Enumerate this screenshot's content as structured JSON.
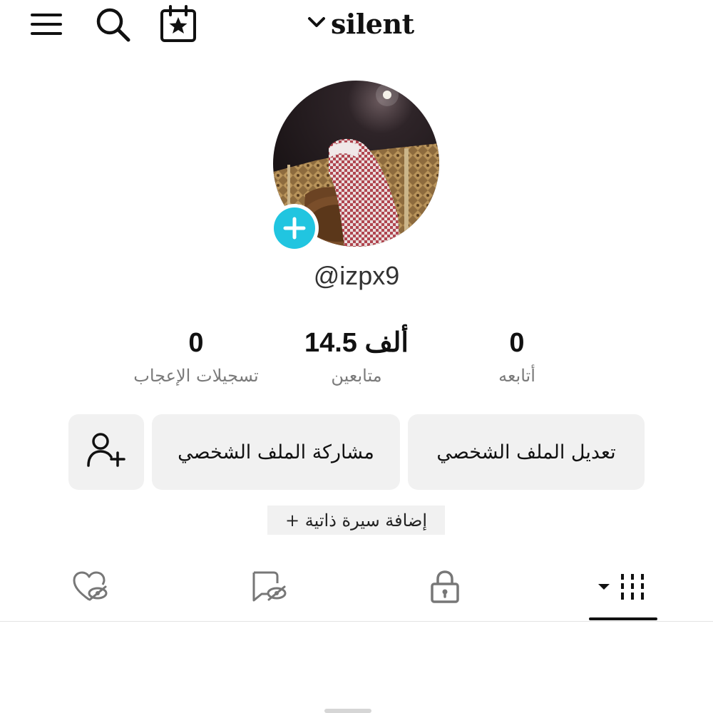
{
  "header": {
    "username": "silent",
    "icons": [
      "menu-icon",
      "search-icon",
      "calendar-star-icon",
      "chevron-down-icon"
    ]
  },
  "profile": {
    "handle": "@izpx9",
    "avatar": "profile-photo",
    "add_badge_icon": "plus-icon"
  },
  "stats": {
    "likes": {
      "value": "0",
      "label": "تسجيلات الإعجاب"
    },
    "followers": {
      "value": "14.5 ألف",
      "label": "متابعين"
    },
    "following": {
      "value": "0",
      "label": "أتابعه"
    }
  },
  "actions": {
    "edit_profile": "تعديل الملف الشخصي",
    "share_profile": "مشاركة الملف الشخصي",
    "add_friend_icon": "add-user-icon"
  },
  "bio": {
    "label": "+ إضافة سيرة ذاتية"
  },
  "tabs": [
    {
      "name": "videos",
      "icon": "grid-icon",
      "active": true
    },
    {
      "name": "private",
      "icon": "lock-icon",
      "active": false
    },
    {
      "name": "reposts",
      "icon": "repost-hidden-icon",
      "active": false
    },
    {
      "name": "liked",
      "icon": "heart-hidden-icon",
      "active": false
    }
  ],
  "colors": {
    "accent": "#21c5e0",
    "button_bg": "#f1f1f1",
    "muted_text": "#7a7a7a"
  }
}
